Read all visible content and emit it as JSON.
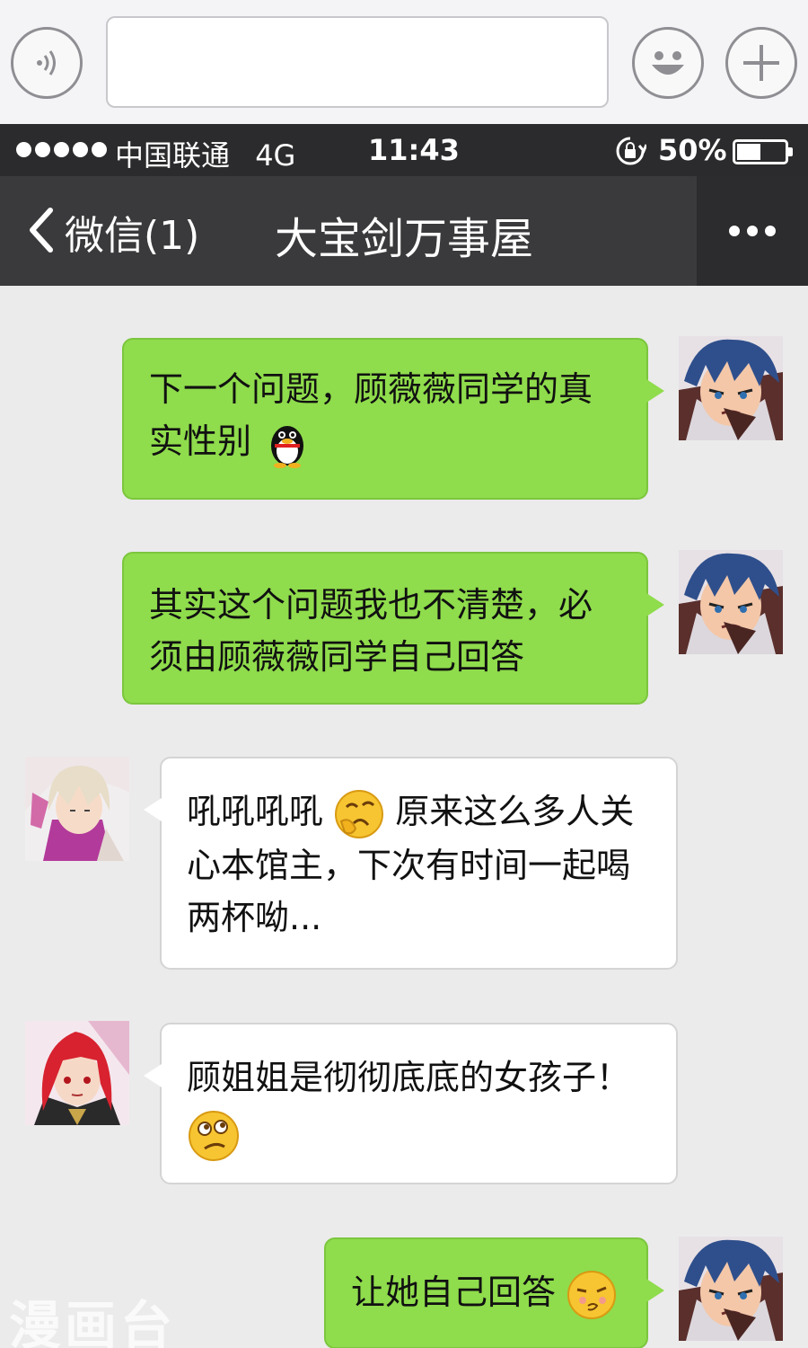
{
  "input_bar": {
    "message_value": ""
  },
  "status_bar": {
    "carrier": "中国联通",
    "network": "4G",
    "time": "11:43",
    "battery": "50%",
    "battery_level": 0.5
  },
  "nav": {
    "back_label": "微信(1)",
    "title": "大宝剑万事屋"
  },
  "messages": [
    {
      "side": "right",
      "parts": [
        "下一个问题，顾薇薇同学的真",
        "实性别"
      ],
      "emoji": "qq-penguin-icon"
    },
    {
      "side": "right",
      "parts": [
        "其实这个问题我也不清楚，必",
        "须由顾薇薇同学自己回答"
      ]
    },
    {
      "side": "left",
      "parts": [
        "吼吼吼吼",
        "原来这么多人关",
        "心本馆主，下次有时间一起喝",
        "两杯呦..."
      ],
      "emoji": "thinking-face-icon"
    },
    {
      "side": "left",
      "parts": [
        "顾姐姐是彻彻底底的女孩子！"
      ],
      "emoji": "confused-face-icon"
    },
    {
      "side": "right",
      "parts": [
        "让她自己回答"
      ],
      "emoji": "smirk-face-icon"
    }
  ],
  "watermark": "漫画台",
  "colors": {
    "my_bubble": "#8fdc4c",
    "their_bubble": "#ffffff",
    "nav_bg": "#3a3a3c",
    "status_bg": "#2b2b2d"
  }
}
